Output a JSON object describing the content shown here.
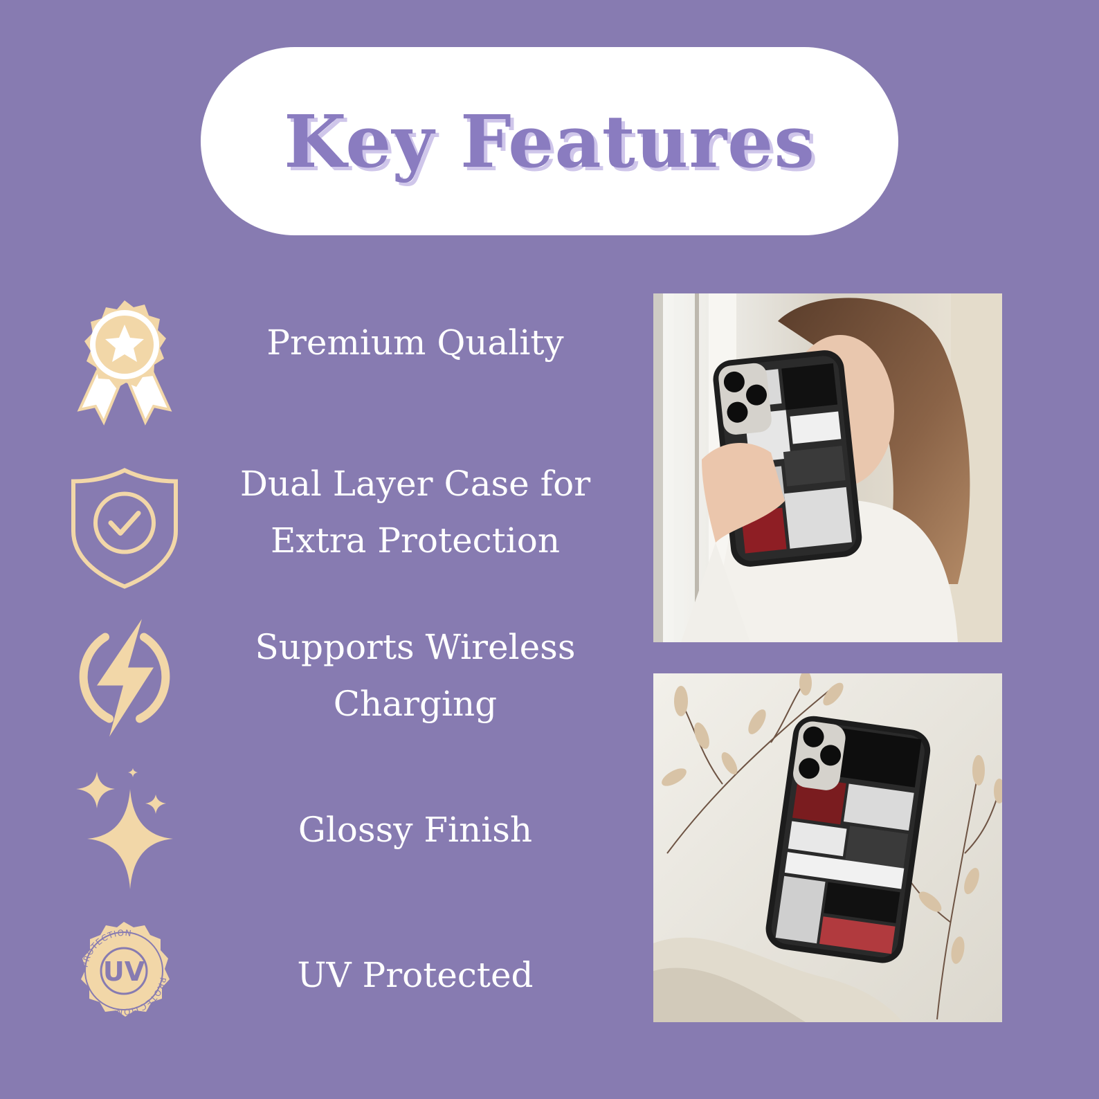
{
  "title": "Key Features",
  "features": [
    {
      "lines": [
        "Premium Quality"
      ],
      "icon": "award-ribbon-icon"
    },
    {
      "lines": [
        "Dual Layer Case for",
        "Extra Protection"
      ],
      "icon": "shield-check-icon"
    },
    {
      "lines": [
        "Supports Wireless",
        "Charging"
      ],
      "icon": "lightning-bolt-icon"
    },
    {
      "lines": [
        "Glossy Finish"
      ],
      "icon": "sparkles-icon"
    },
    {
      "lines": [
        "UV Protected"
      ],
      "icon": "uv-protection-badge-icon"
    }
  ],
  "uv_badge": {
    "center": "UV",
    "ring": "PROTECTION"
  },
  "photos": [
    {
      "name": "woman-holding-phone-photo"
    },
    {
      "name": "phone-on-table-with-dried-flowers-photo"
    }
  ],
  "colors": {
    "background": "#877BB1",
    "title": "#8A7CC0",
    "title_shadow": "#CFC6EA",
    "icon": "#F2D7A8",
    "text": "#FFFFFF"
  }
}
